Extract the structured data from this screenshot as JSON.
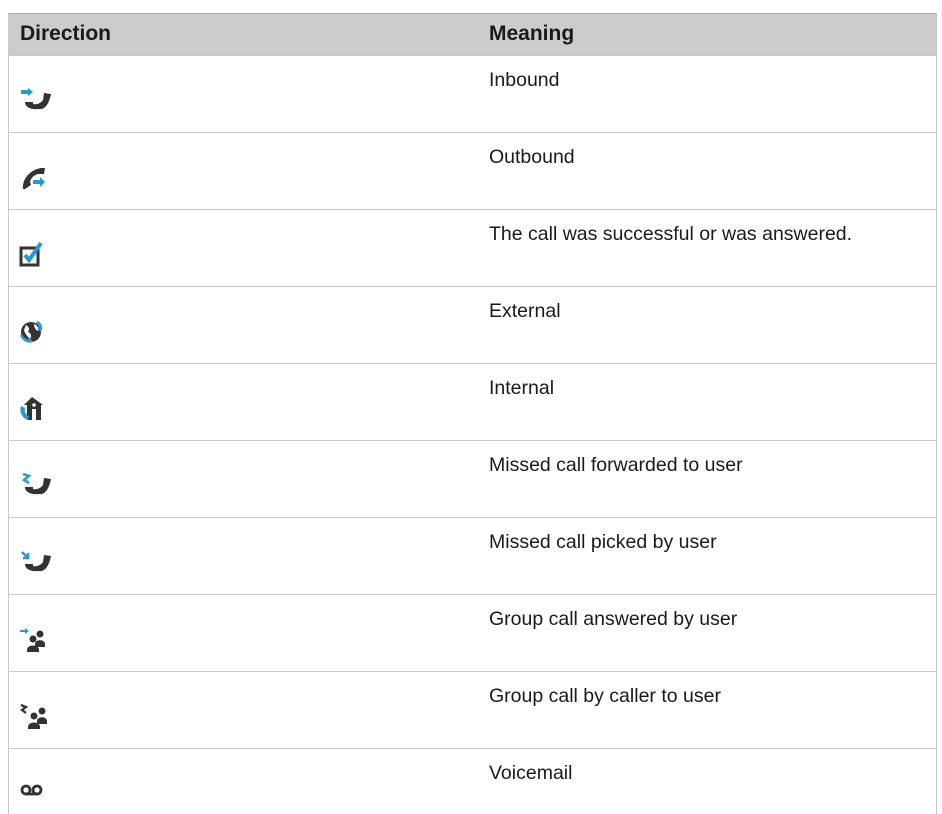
{
  "table": {
    "headers": {
      "direction": "Direction",
      "meaning": "Meaning"
    },
    "rows": [
      {
        "icon": "inbound-call-icon",
        "meaning": "Inbound"
      },
      {
        "icon": "outbound-call-icon",
        "meaning": "Outbound"
      },
      {
        "icon": "checkbox-checked-icon",
        "meaning": "The call was successful or was answered."
      },
      {
        "icon": "external-globe-call-icon",
        "meaning": "External"
      },
      {
        "icon": "internal-house-call-icon",
        "meaning": "Internal"
      },
      {
        "icon": "missed-call-forwarded-icon",
        "meaning": "Missed call forwarded to user"
      },
      {
        "icon": "missed-call-picked-icon",
        "meaning": "Missed call picked by user"
      },
      {
        "icon": "group-call-answered-icon",
        "meaning": "Group call answered by user"
      },
      {
        "icon": "group-call-by-caller-icon",
        "meaning": "Group call by caller to user"
      },
      {
        "icon": "voicemail-icon",
        "meaning": "Voicemail"
      }
    ]
  },
  "colors": {
    "header_bg": "#cccccc",
    "icon_dark": "#333333",
    "icon_blue": "#1f9bdc",
    "grid_line": "#c8c8c8"
  }
}
